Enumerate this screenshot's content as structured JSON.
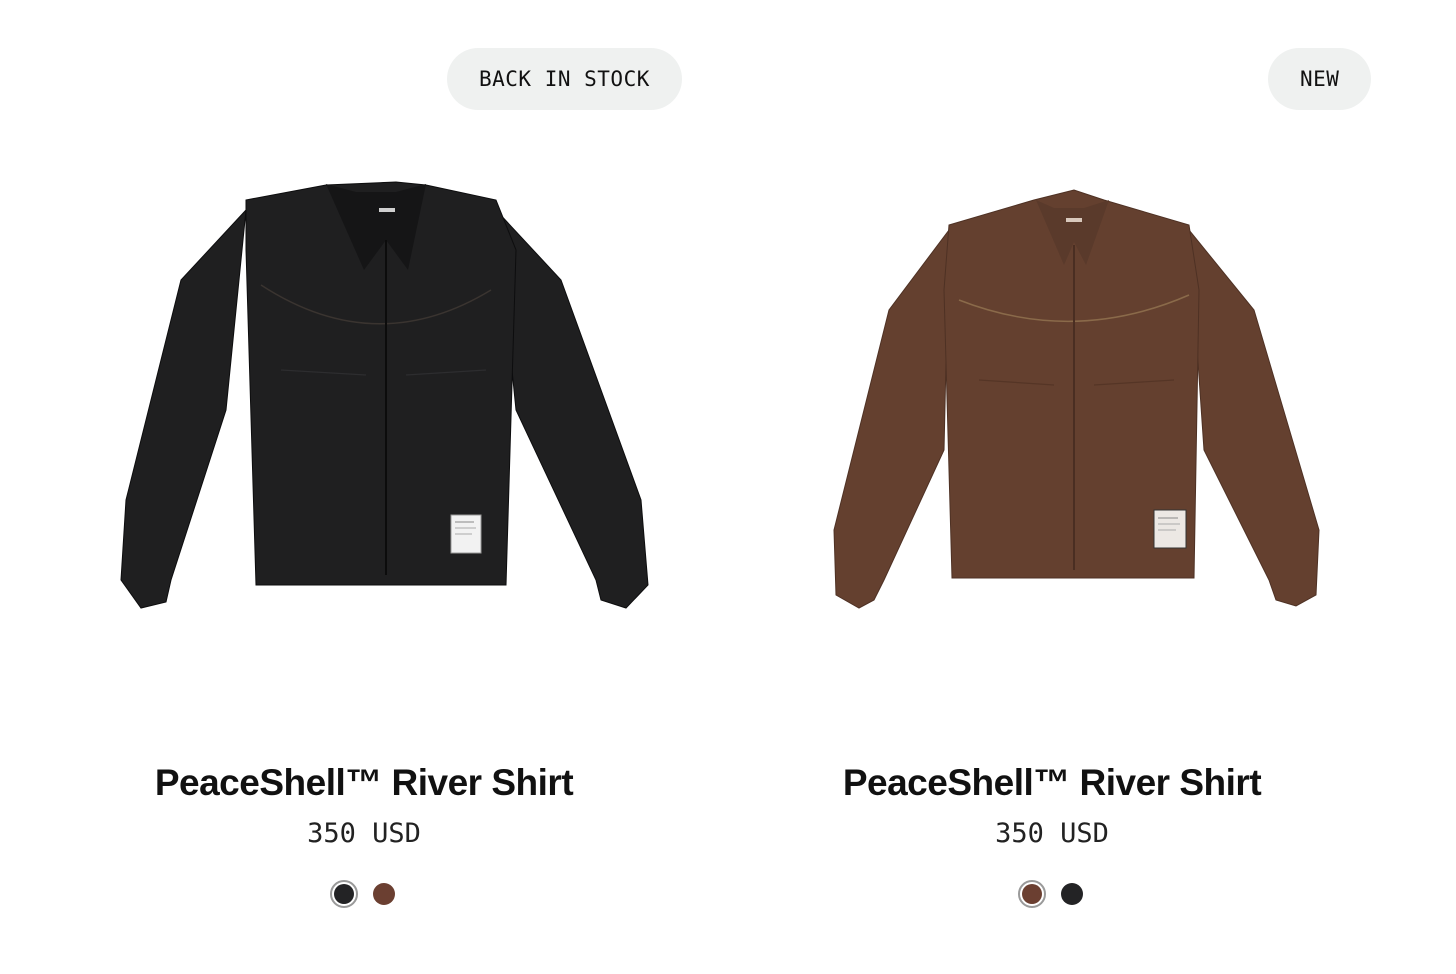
{
  "products": [
    {
      "badge": "BACK IN STOCK",
      "title": "PeaceShell™ River Shirt",
      "price": "350 USD",
      "image": {
        "icon": "black-shirt-image",
        "color": "#1f1f20"
      },
      "swatches": [
        {
          "name": "black",
          "color": "#232325",
          "selected": true
        },
        {
          "name": "brown",
          "color": "#6b3f31",
          "selected": false
        }
      ]
    },
    {
      "badge": "NEW",
      "title": "PeaceShell™ River Shirt",
      "price": "350 USD",
      "image": {
        "icon": "brown-shirt-image",
        "color": "#64402f"
      },
      "swatches": [
        {
          "name": "brown",
          "color": "#6b3f31",
          "selected": true
        },
        {
          "name": "black",
          "color": "#232325",
          "selected": false
        }
      ]
    }
  ]
}
